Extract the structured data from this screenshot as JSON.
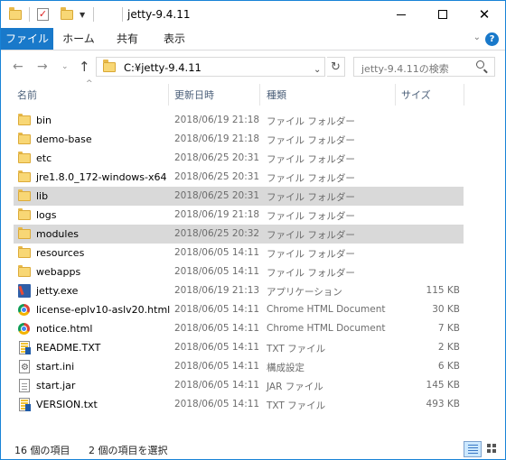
{
  "window": {
    "title": "jetty-9.4.11"
  },
  "ribbon": {
    "tabs": [
      "ファイル",
      "ホーム",
      "共有",
      "表示"
    ]
  },
  "address": {
    "path": "C:¥jetty-9.4.11",
    "search_placeholder": "jetty-9.4.11の検索"
  },
  "columns": {
    "name": "名前",
    "date": "更新日時",
    "type": "種類",
    "size": "サイズ"
  },
  "files": [
    {
      "name": "bin",
      "date": "2018/06/19 21:18",
      "type": "ファイル フォルダー",
      "size": "",
      "icon": "folder",
      "selected": false
    },
    {
      "name": "demo-base",
      "date": "2018/06/19 21:18",
      "type": "ファイル フォルダー",
      "size": "",
      "icon": "folder",
      "selected": false
    },
    {
      "name": "etc",
      "date": "2018/06/25 20:31",
      "type": "ファイル フォルダー",
      "size": "",
      "icon": "folder",
      "selected": false
    },
    {
      "name": "jre1.8.0_172-windows-x64",
      "date": "2018/06/25 20:31",
      "type": "ファイル フォルダー",
      "size": "",
      "icon": "folder",
      "selected": false
    },
    {
      "name": "lib",
      "date": "2018/06/25 20:31",
      "type": "ファイル フォルダー",
      "size": "",
      "icon": "folder",
      "selected": true
    },
    {
      "name": "logs",
      "date": "2018/06/19 21:18",
      "type": "ファイル フォルダー",
      "size": "",
      "icon": "folder",
      "selected": false
    },
    {
      "name": "modules",
      "date": "2018/06/25 20:32",
      "type": "ファイル フォルダー",
      "size": "",
      "icon": "folder",
      "selected": true
    },
    {
      "name": "resources",
      "date": "2018/06/05 14:11",
      "type": "ファイル フォルダー",
      "size": "",
      "icon": "folder",
      "selected": false
    },
    {
      "name": "webapps",
      "date": "2018/06/05 14:11",
      "type": "ファイル フォルダー",
      "size": "",
      "icon": "folder",
      "selected": false
    },
    {
      "name": "jetty.exe",
      "date": "2018/06/19 21:13",
      "type": "アプリケーション",
      "size": "115 KB",
      "icon": "exe",
      "selected": false
    },
    {
      "name": "license-eplv10-aslv20.html",
      "date": "2018/06/05 14:11",
      "type": "Chrome HTML Document",
      "size": "30 KB",
      "icon": "chrome",
      "selected": false
    },
    {
      "name": "notice.html",
      "date": "2018/06/05 14:11",
      "type": "Chrome HTML Document",
      "size": "7 KB",
      "icon": "chrome",
      "selected": false
    },
    {
      "name": "README.TXT",
      "date": "2018/06/05 14:11",
      "type": "TXT ファイル",
      "size": "2 KB",
      "icon": "text-color",
      "selected": false
    },
    {
      "name": "start.ini",
      "date": "2018/06/05 14:11",
      "type": "構成設定",
      "size": "6 KB",
      "icon": "ini",
      "selected": false
    },
    {
      "name": "start.jar",
      "date": "2018/06/05 14:11",
      "type": "JAR ファイル",
      "size": "145 KB",
      "icon": "doc",
      "selected": false
    },
    {
      "name": "VERSION.txt",
      "date": "2018/06/05 14:11",
      "type": "TXT ファイル",
      "size": "493 KB",
      "icon": "text-color",
      "selected": false
    }
  ],
  "status": {
    "item_count": "16 個の項目",
    "selected_count": "2 個の項目を選択"
  },
  "colors": {
    "accent": "#1979ca",
    "selected_row": "#d9d9d9",
    "header_text": "#4c607a"
  }
}
